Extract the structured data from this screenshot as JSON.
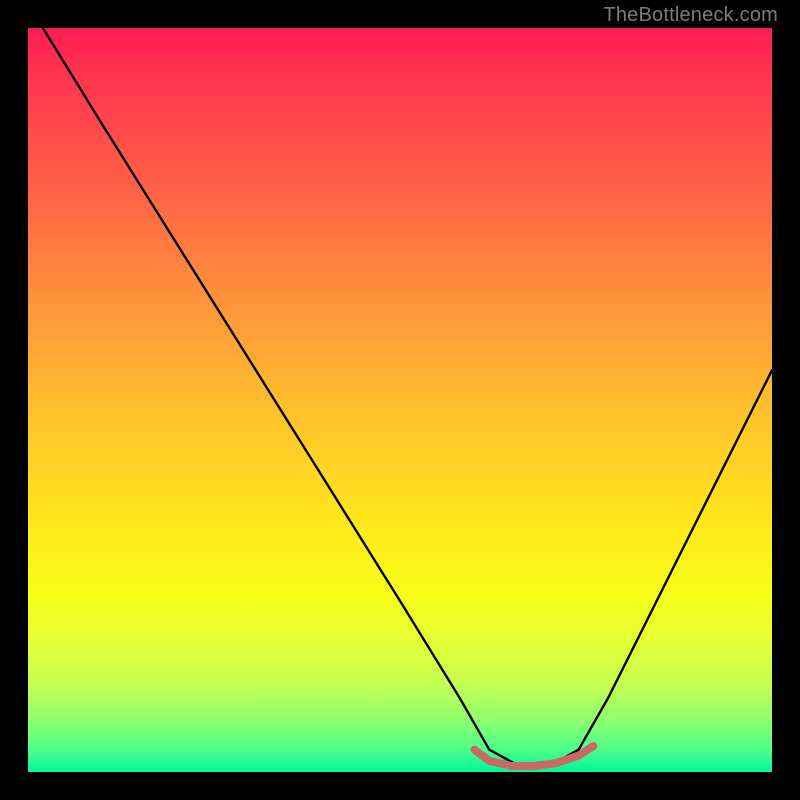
{
  "watermark": {
    "text": "TheBottleneck.com"
  },
  "chart_data": {
    "type": "line",
    "title": "",
    "xlabel": "",
    "ylabel": "",
    "xlim": [
      0,
      100
    ],
    "ylim": [
      0,
      100
    ],
    "grid": false,
    "legend": "none",
    "series": [
      {
        "name": "bottleneck-curve",
        "color": "#000000",
        "x": [
          2,
          10,
          20,
          30,
          40,
          50,
          58,
          62,
          66,
          70,
          74,
          78,
          82,
          90,
          100
        ],
        "y": [
          100,
          87,
          71,
          55,
          39,
          23,
          10,
          3,
          0.8,
          0.8,
          3,
          10,
          18,
          34,
          54
        ]
      },
      {
        "name": "valley-highlight",
        "color": "#c86a62",
        "x": [
          60,
          62,
          65,
          68,
          71,
          74,
          76
        ],
        "y": [
          3.0,
          1.5,
          0.8,
          0.8,
          1.2,
          2.2,
          3.5
        ]
      }
    ],
    "annotations": [],
    "background_gradient": {
      "top": "#ff1c54",
      "bottom": "#00f59a"
    }
  }
}
